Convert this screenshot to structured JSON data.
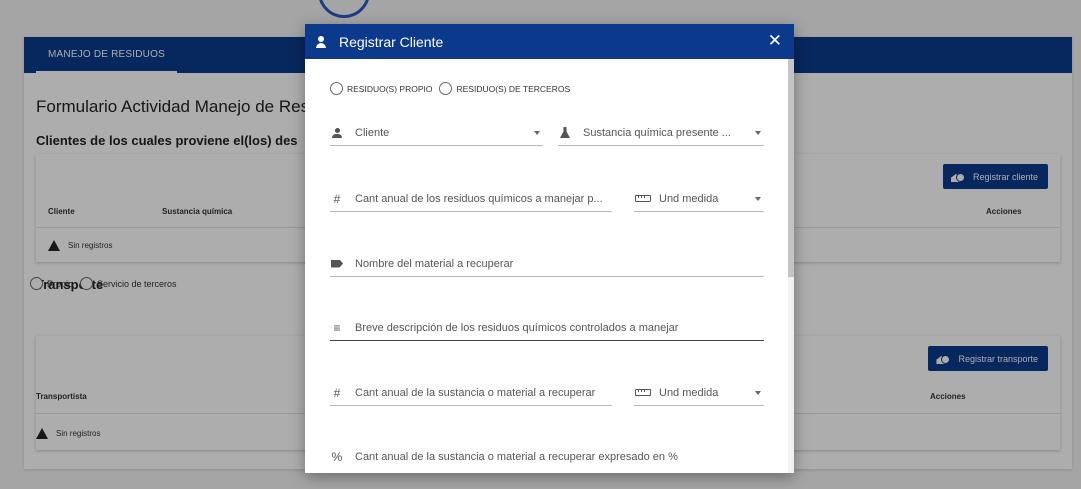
{
  "background": {
    "tab_label": "MANEJO DE RESIDUOS",
    "form_title": "Formulario Actividad Manejo de Res",
    "clientes_section": {
      "title": "Clientes de los cuales proviene el(los) des",
      "button_label": "Registrar cliente",
      "columns": [
        "Cliente",
        "Sustancia química",
        "Acciones"
      ],
      "empty_text": "Sin registros"
    },
    "transporte_section": {
      "title": "Transporte",
      "radio_options": [
        "Propio",
        "Servicio de terceros"
      ],
      "button_label": "Registrar transporte",
      "columns": [
        "Transportista",
        "Acciones"
      ],
      "empty_text": "Sin registros"
    }
  },
  "modal": {
    "title": "Registrar Cliente",
    "close_glyph": "✕",
    "radio_options": [
      "RESIDUO(S) PROPIO",
      "RESIDUO(S) DE TERCEROS"
    ],
    "fields": {
      "cliente": "Cliente",
      "sustancia": "Sustancia química presente ...",
      "cant_anual_residuos": "Cant anual de los residuos químicos a manejar p...",
      "und_medida_1": "Und medida",
      "nombre_material": "Nombre del material a recuperar",
      "breve_descripcion": "Breve descripción de los residuos químicos controlados a manejar",
      "cant_anual_sustancia": "Cant anual de la sustancia o material a recuperar",
      "und_medida_2": "Und medida",
      "cant_anual_porcentaje": "Cant anual de la sustancia o material a recuperar expresado en %"
    },
    "icons": {
      "hash": "#",
      "percent": "%",
      "list": "≡"
    }
  },
  "colors": {
    "primary": "#0b3a8c"
  }
}
